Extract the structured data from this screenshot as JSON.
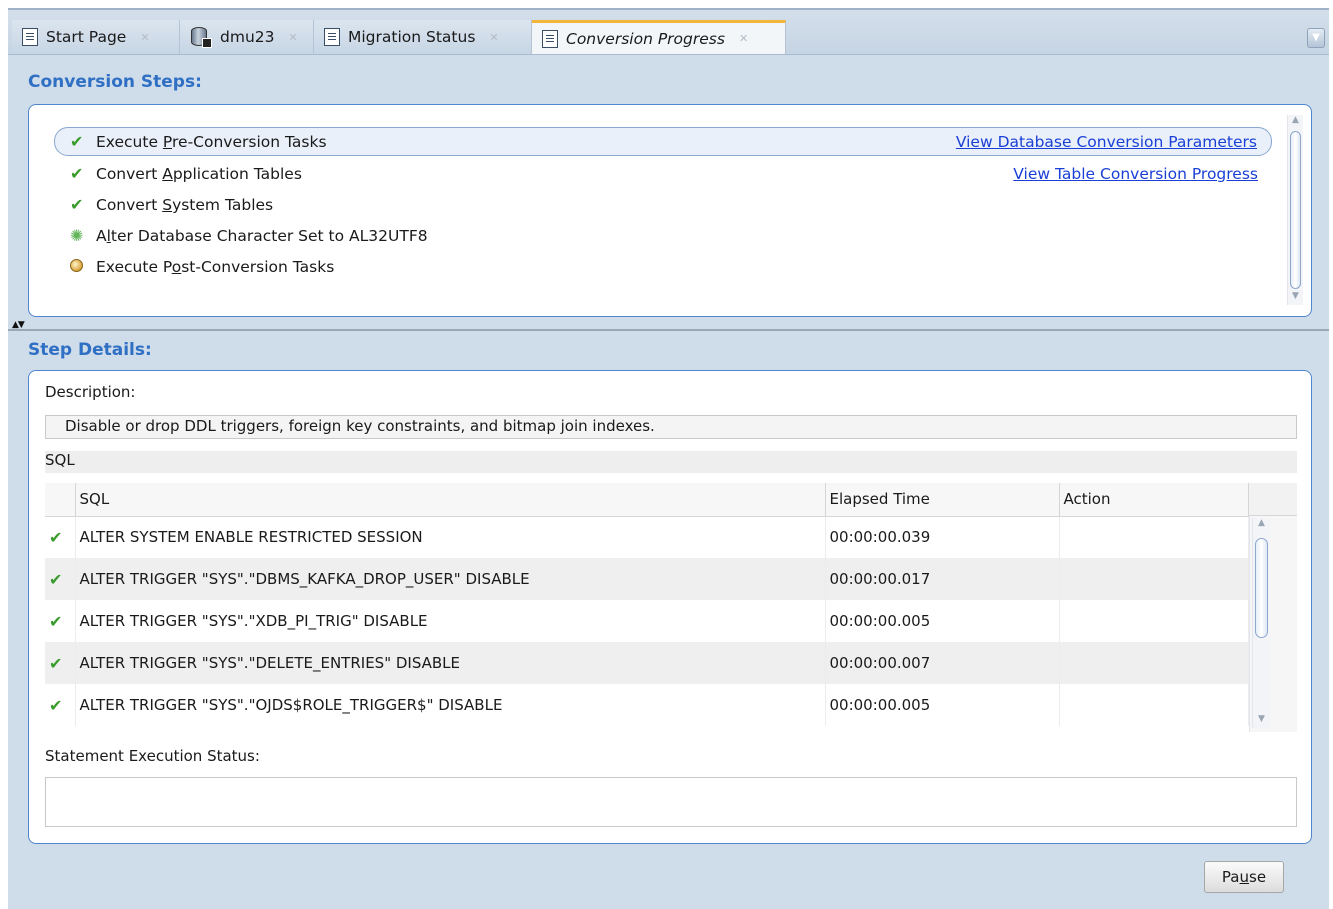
{
  "tabs": [
    {
      "label": "Start Page",
      "icon": "document-icon",
      "active": false
    },
    {
      "label": "dmu23",
      "icon": "database-icon",
      "active": false
    },
    {
      "label": "Migration Status",
      "icon": "document-icon",
      "active": false
    },
    {
      "label": "Conversion Progress",
      "icon": "document-icon",
      "active": true
    }
  ],
  "conversion_steps": {
    "title": "Conversion Steps:",
    "items": [
      {
        "pre": "Execute ",
        "mn": "P",
        "post": "re-Conversion Tasks",
        "status": "done",
        "selected": true
      },
      {
        "pre": "Convert ",
        "mn": "A",
        "post": "pplication Tables",
        "status": "done",
        "selected": false
      },
      {
        "pre": "Convert ",
        "mn": "S",
        "post": "ystem Tables",
        "status": "done",
        "selected": false
      },
      {
        "pre": "A",
        "mn": "l",
        "post": "ter Database Character Set to AL32UTF8",
        "status": "in-progress",
        "selected": false
      },
      {
        "pre": "Execute P",
        "mn": "o",
        "post": "st-Conversion Tasks",
        "status": "pending",
        "selected": false
      }
    ],
    "links": {
      "db_params": "View Database Conversion Parameters",
      "table_progress": "View Table Conversion Progress"
    }
  },
  "step_details": {
    "title": "Step Details:",
    "description_label": "Description:",
    "description": "Disable or drop DDL triggers, foreign key constraints, and bitmap join indexes.",
    "sql_section_label": "SQL",
    "columns": [
      "SQL",
      "Elapsed Time",
      "Action"
    ],
    "rows": [
      {
        "sql": "ALTER SYSTEM ENABLE RESTRICTED SESSION",
        "elapsed": "00:00:00.039",
        "action": ""
      },
      {
        "sql": "ALTER TRIGGER \"SYS\".\"DBMS_KAFKA_DROP_USER\" DISABLE",
        "elapsed": "00:00:00.017",
        "action": ""
      },
      {
        "sql": "ALTER TRIGGER \"SYS\".\"XDB_PI_TRIG\" DISABLE",
        "elapsed": "00:00:00.005",
        "action": ""
      },
      {
        "sql": "ALTER TRIGGER \"SYS\".\"DELETE_ENTRIES\" DISABLE",
        "elapsed": "00:00:00.007",
        "action": ""
      },
      {
        "sql": "ALTER TRIGGER \"SYS\".\"OJDS$ROLE_TRIGGER$\" DISABLE",
        "elapsed": "00:00:00.005",
        "action": ""
      }
    ],
    "execution_status_label": "Statement Execution Status:",
    "execution_status": ""
  },
  "pause_button": {
    "pre": "Pa",
    "mn": "u",
    "post": "se"
  },
  "colors": {
    "accent": "#2f6fc4",
    "link": "#1a3fd6",
    "success": "#3a9c2c",
    "tab_highlight": "#f2b73a"
  }
}
